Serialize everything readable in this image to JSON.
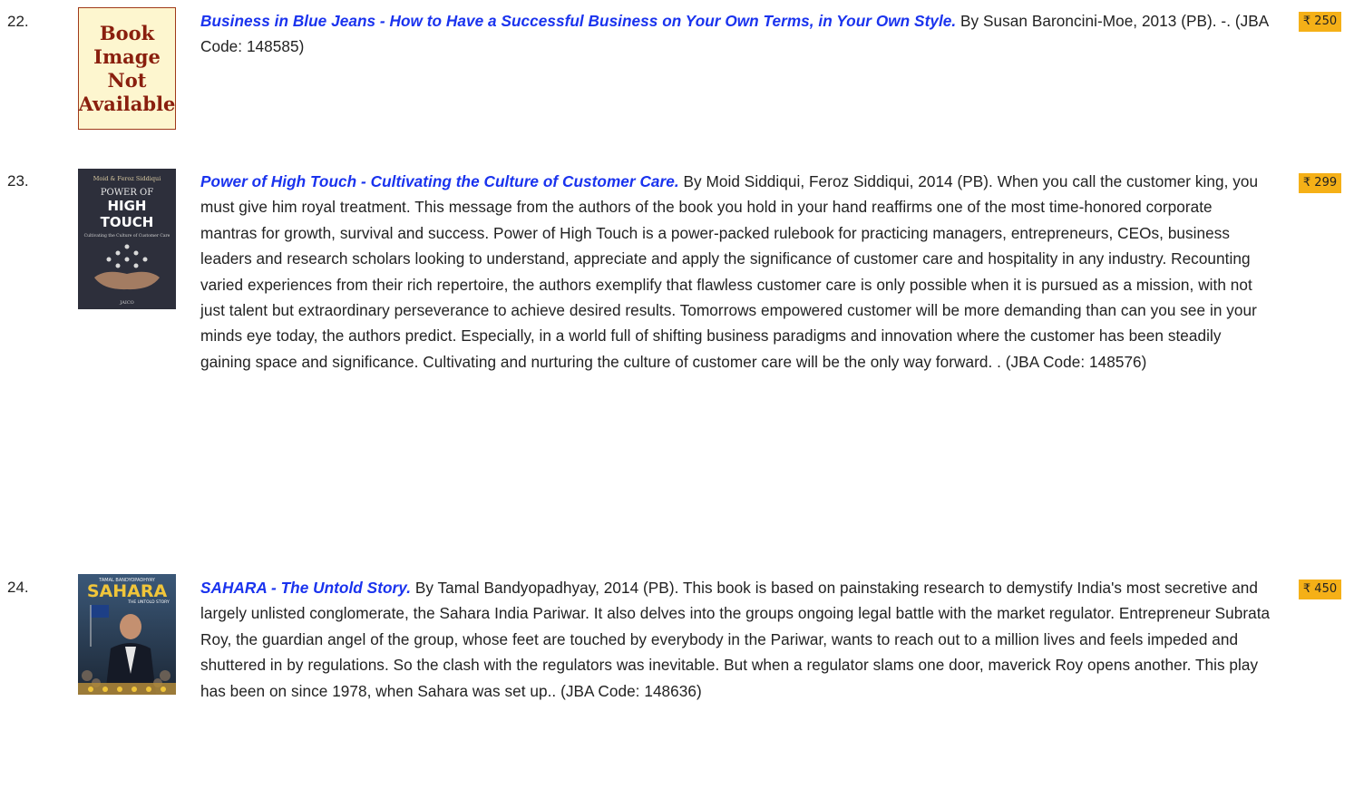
{
  "currency_symbol": "₹",
  "entries": [
    {
      "number": "22.",
      "cover_type": "placeholder",
      "placeholder_lines": [
        "Book Image",
        "Not",
        "Available"
      ],
      "title": "Business in Blue Jeans - How to Have a Successful Business on Your Own Terms, in Your Own Style.",
      "details": " By Susan Baroncini-Moe, 2013 (PB). -. (JBA Code: 148585)",
      "price": "₹ 250"
    },
    {
      "number": "23.",
      "cover_type": "image",
      "cover_text": {
        "authors": "Moid & Feroz Siddiqui",
        "line1": "POWER OF",
        "line2": "HIGH",
        "line3": "TOUCH",
        "subtitle": "Cultivating the Culture of Customer Care",
        "publisher": "JAICO"
      },
      "title": "Power of High Touch - Cultivating the Culture of Customer Care.",
      "details": " By Moid Siddiqui, Feroz Siddiqui, 2014 (PB). When you call the customer king, you must give him royal treatment. This message from the authors of the book you hold in your hand reaffirms one of the most time-honored corporate mantras for growth, survival and success. Power of High Touch is a power-packed rulebook for practicing managers, entrepreneurs, CEOs, business leaders and research scholars looking to understand, appreciate and apply the significance of customer care and hospitality in any industry. Recounting varied experiences from their rich repertoire, the authors exemplify that flawless customer care is only possible when it is pursued as a mission, with not just talent but extraordinary perseverance to achieve desired results. Tomorrows empowered customer will be more demanding than can you see in your minds eye today, the authors predict. Especially, in a world full of shifting business paradigms and innovation where the customer has been steadily gaining space and significance. Cultivating and nurturing the culture of customer care will be the only way forward. . (JBA Code: 148576)",
      "price": "₹ 299"
    },
    {
      "number": "24.",
      "cover_type": "image",
      "cover_text": {
        "author": "TAMAL BANDYOPADHYAY",
        "line1": "SAHARA",
        "subtitle": "THE UNTOLD STORY"
      },
      "title": "SAHARA - The Untold Story.",
      "details": " By Tamal Bandyopadhyay, 2014 (PB). This book is based on painstaking research to demystify India's most secretive and largely unlisted conglomerate, the Sahara India Pariwar. It also delves into the groups ongoing legal battle with the market regulator. Entrepreneur Subrata Roy, the guardian angel of the group, whose feet are touched by everybody in the Pariwar, wants to reach out to a million lives and feels impeded and shuttered in by regulations. So the clash with the regulators was inevitable. But when a regulator slams one door, maverick Roy opens another. This play has been on since 1978, when Sahara was set up.. (JBA Code: 148636)",
      "price": "₹ 450"
    }
  ]
}
